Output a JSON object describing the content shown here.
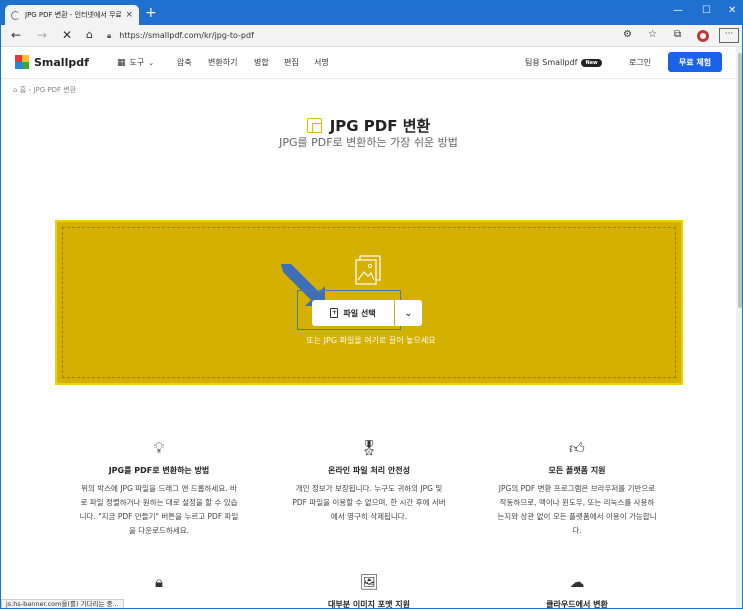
{
  "browser": {
    "tab_title": "JPG PDF 변환 - 인터넷에서 무료",
    "tab_close": "×",
    "new_tab": "+",
    "url": "https://smallpdf.com/kr/jpg-to-pdf",
    "window_controls": [
      "—",
      "☐",
      "✕"
    ],
    "more_label": "···",
    "status_text": "js.hs-banner.com을(를) 기다리는 중..."
  },
  "header": {
    "logo_text": "Smallpdf",
    "tools_label": "도구",
    "nav": [
      "압축",
      "변환하기",
      "병합",
      "편집",
      "서명"
    ],
    "team_label": "팀용 Smallpdf",
    "team_badge": "New",
    "login_label": "로그인",
    "trial_label": "무료 체험"
  },
  "breadcrumb": {
    "home": "홈",
    "separator": "›",
    "current": "JPG PDF 변환"
  },
  "hero": {
    "title": "JPG PDF 변환",
    "subtitle": "JPG를 PDF로 변환하는 가장 쉬운 방법"
  },
  "dropzone": {
    "button_label": "파일 선택",
    "hint": "또는 JPG 파일을 여기로 끌어 놓으세요",
    "color": "#d4b000"
  },
  "features": [
    {
      "icon": "lightbulb-icon",
      "title": "JPG를 PDF로 변환하는 방법",
      "desc": "위의 박스에 JPG 파일을 드래그 앤 드롭하세요. 바로 파일 정렬하거나 원하는 대로 설정을 할 수 있습니다. \"지금 PDF 만들기\" 버튼을 누르고 PDF 파일을 다운로드하세요."
    },
    {
      "icon": "badge-icon",
      "title": "온라인 파일 처리 안전성",
      "desc": "개인 정보가 보장됩니다. 누구도 귀하의 JPG 및 PDF 파일을 이용할 수 없으며, 한 시간 후에 서버에서 영구히 삭제됩니다."
    },
    {
      "icon": "thumbs-up-icon",
      "title": "모든 플랫폼 지원",
      "desc": "JPG의 PDF 변환 프로그램은 브라우저를 기반으로 작동하므로, 맥이나 윈도우, 또는 리눅스를 사용하는지와 상관 없이 모든 플랫폼에서 이용이 가능합니다."
    }
  ],
  "features_row2": [
    {
      "icon": "lock-icon",
      "title": ""
    },
    {
      "icon": "images-icon",
      "title": "대부분 이미지 포맷 지원"
    },
    {
      "icon": "cloud-upload-icon",
      "title": "클라우드에서 변환"
    }
  ]
}
